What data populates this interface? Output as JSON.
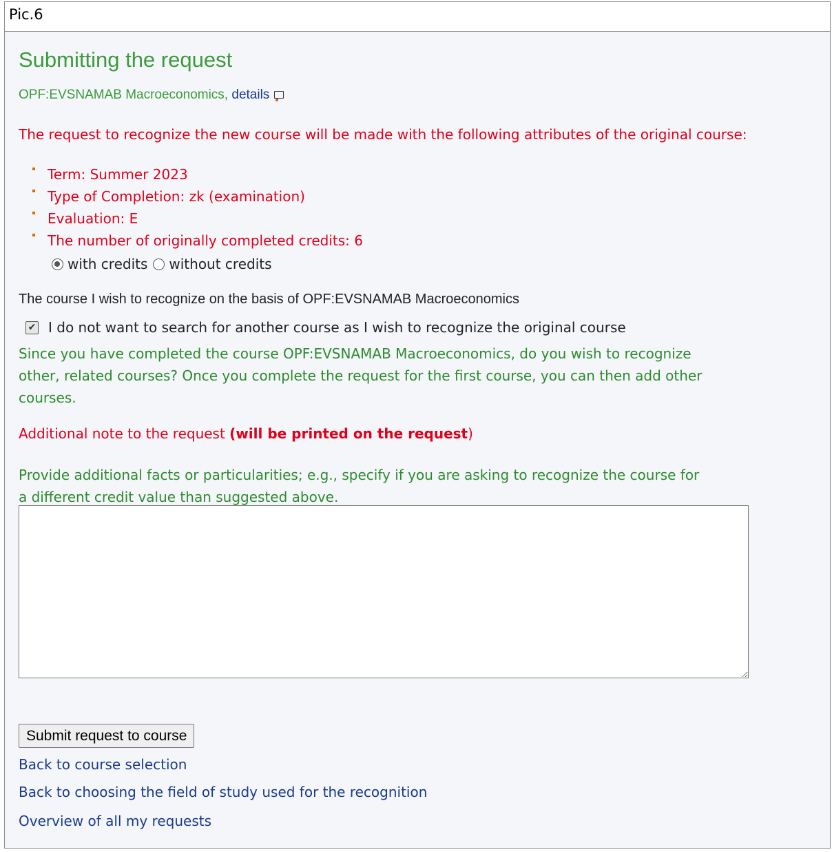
{
  "caption": "Pic.6",
  "title": "Submitting the request",
  "course": {
    "code_name": "OPF:EVSNAMAB Macroeconomics,",
    "details_link": "details",
    "details_icon": "external-window-icon"
  },
  "intro": "The request to recognize the new course will be made with the following attributes of the original course:",
  "attributes": [
    "Term: Summer 2023",
    "Type of Completion: zk (examination)",
    "Evaluation: E",
    "The number of originally completed credits: 6"
  ],
  "credit_options": {
    "with_label": "with credits",
    "without_label": "without credits",
    "selected": "with credits"
  },
  "basis_label": "The course I wish to recognize on the basis of OPF:EVSNAMAB Macroeconomics",
  "no_search_checkbox": {
    "label": "I do not want to search for another course as I wish to recognize the original course",
    "checked": true
  },
  "related_text": "Since you have completed the course OPF:EVSNAMAB Macroeconomics, do you wish to recognize other, related courses? Once you complete the request for the first course, you can then add other courses.",
  "note": {
    "label": "Additional note to the request ",
    "bold": "(will be printed on the request",
    "suffix": ")",
    "hint": "Provide additional facts or particularities; e.g., specify if you are asking to recognize the course for a different credit value than suggested above.",
    "value": ""
  },
  "submit_label": "Submit request to course",
  "links": [
    "Back to course selection",
    "Back to choosing the field of study used for the recognition",
    "Overview of all my requests"
  ],
  "colors": {
    "green": "#3c9a3c",
    "red": "#e0001a",
    "link": "#1a3a8a"
  }
}
